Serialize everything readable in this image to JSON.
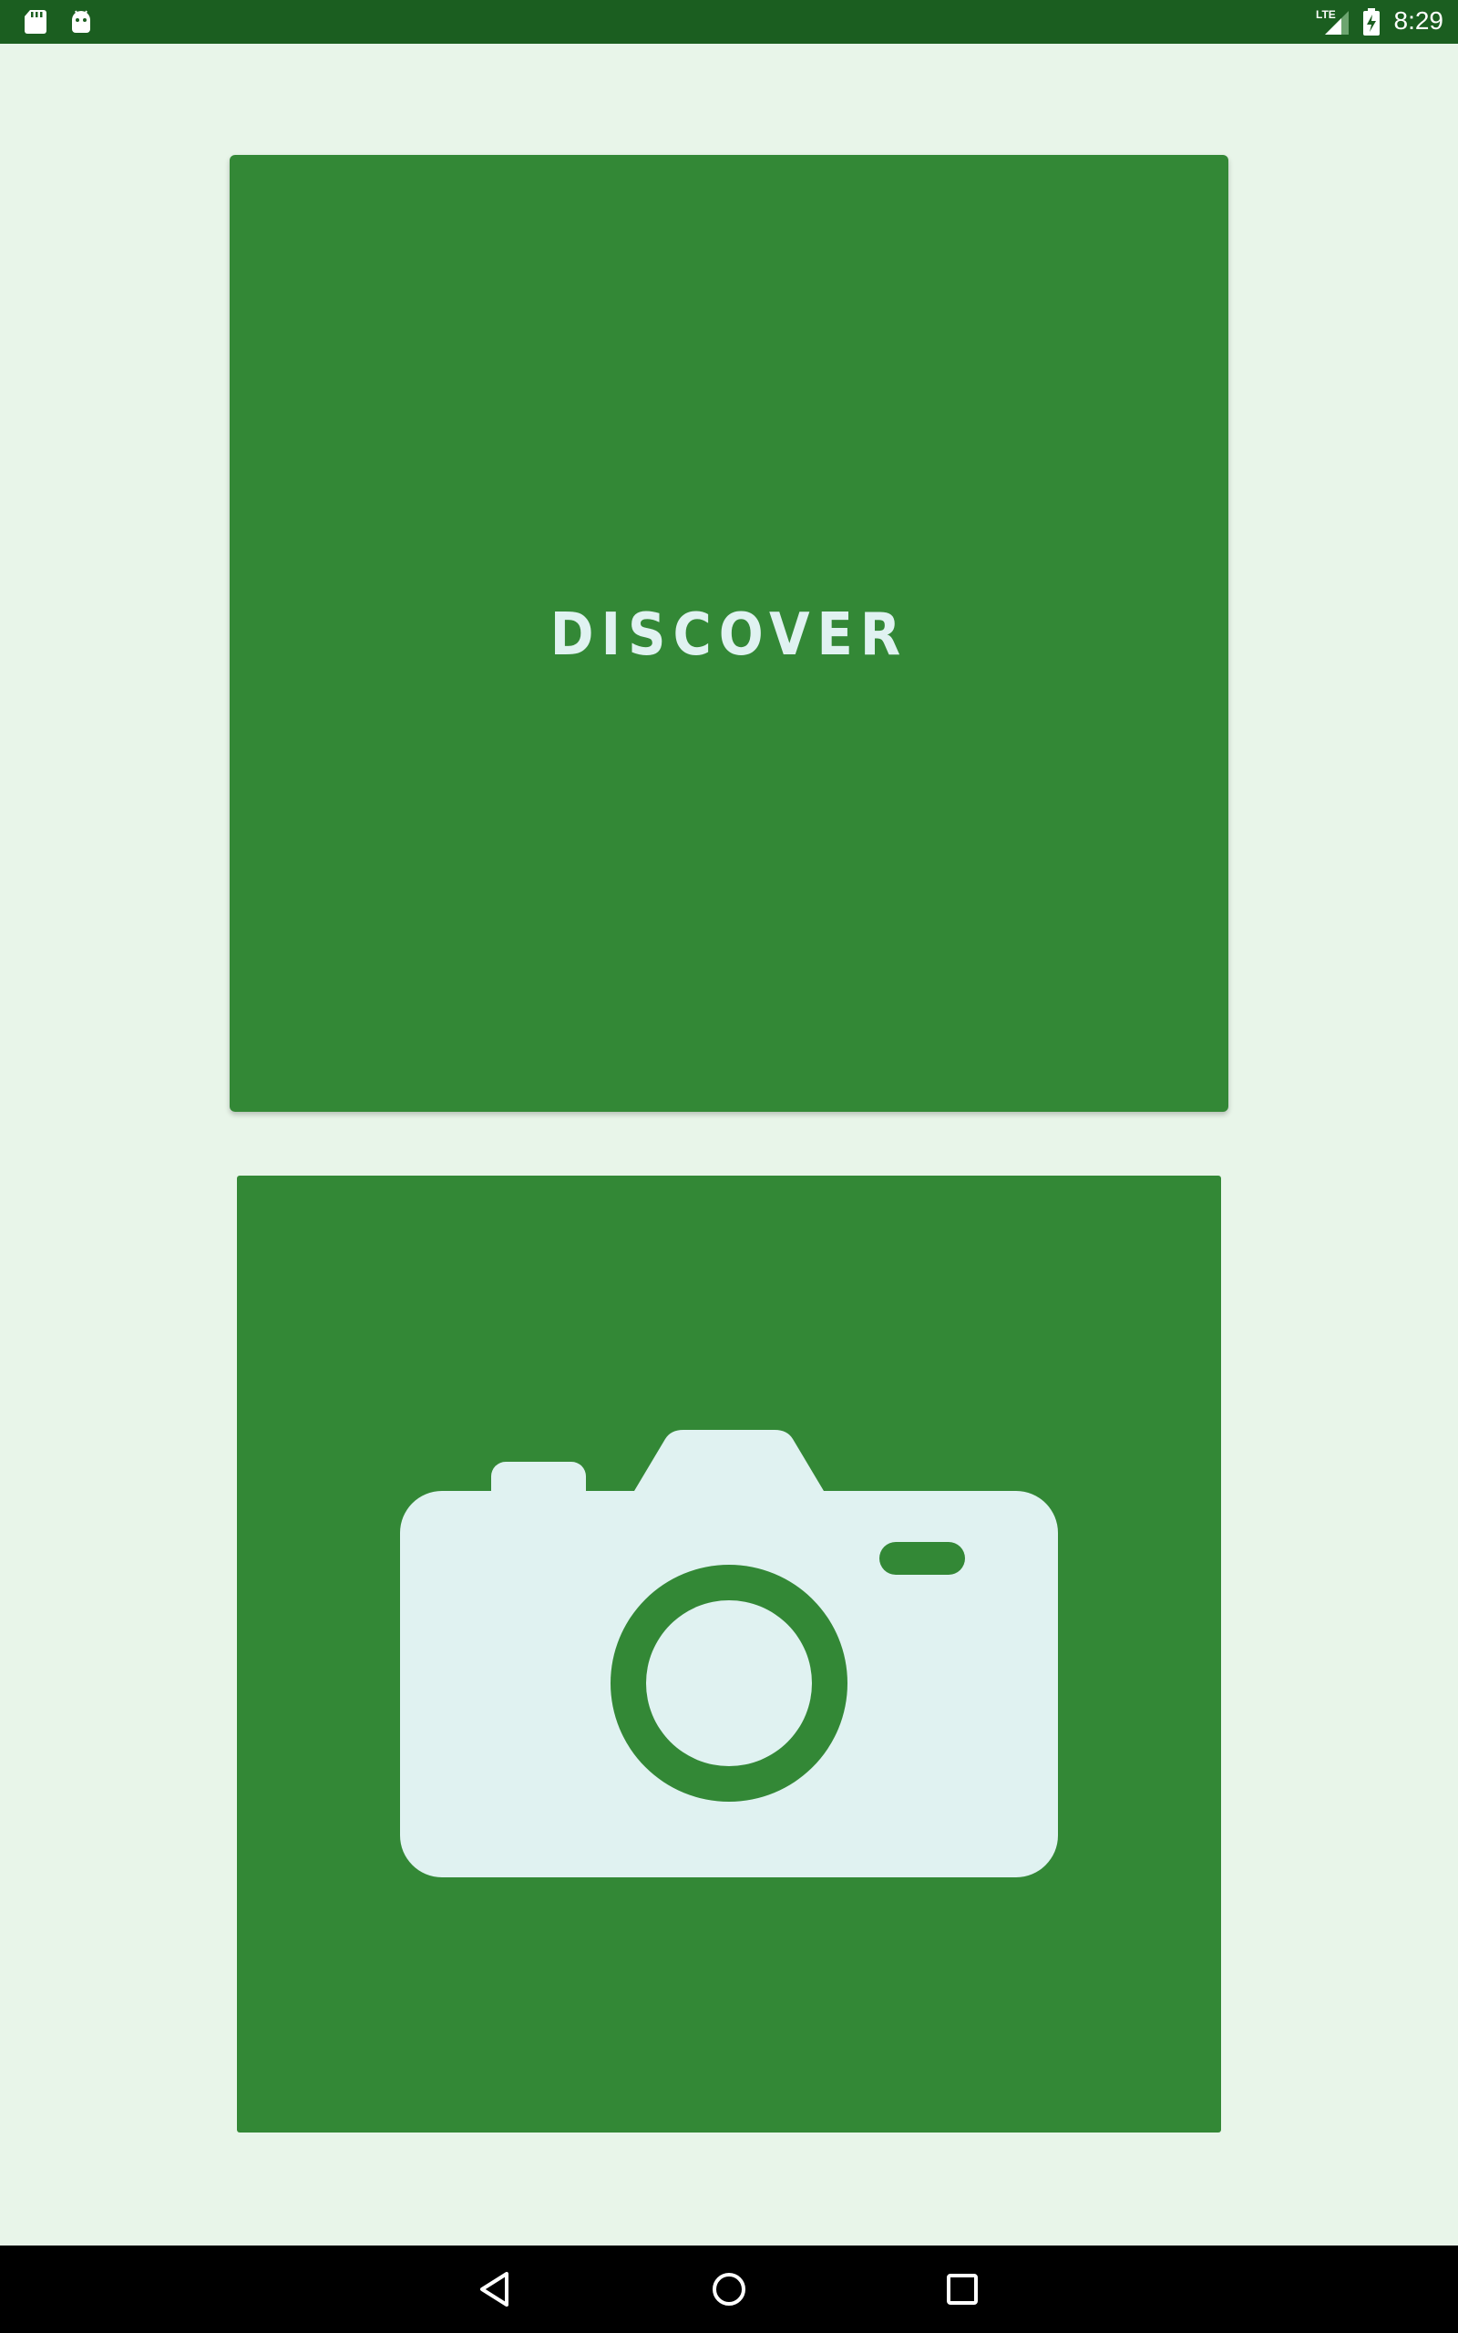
{
  "status_bar": {
    "time": "8:29",
    "network_label": "LTE",
    "icons": [
      "sd-card-icon",
      "android-debug-icon",
      "lte-signal-icon",
      "battery-charging-icon"
    ]
  },
  "discover_card": {
    "label": "DISCOVER"
  },
  "camera_card": {
    "icon": "camera-icon"
  },
  "nav_bar": {
    "icons": [
      "back-icon",
      "home-icon",
      "recents-icon"
    ]
  },
  "colors": {
    "status_bar": "#1b5e20",
    "background": "#e8f5e9",
    "card": "#338836",
    "icon_fill": "#e0f2f1",
    "nav_bar": "#000000"
  }
}
